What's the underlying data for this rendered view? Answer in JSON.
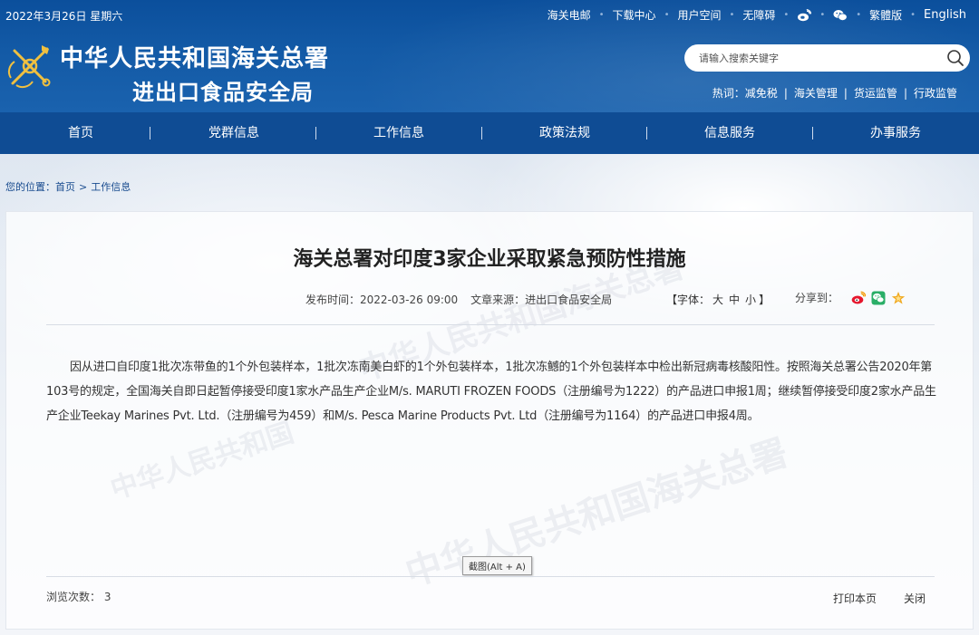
{
  "topbar": {
    "date": "2022年3月26日 星期六",
    "links": [
      {
        "label": "海关电邮"
      },
      {
        "label": "下载中心"
      },
      {
        "label": "用户空间"
      },
      {
        "label": "无障碍"
      },
      {
        "icon": "weibo-icon"
      },
      {
        "icon": "wechat-icon"
      },
      {
        "label": "繁體版"
      },
      {
        "label": "English"
      }
    ]
  },
  "brand": {
    "line1": "中华人民共和国海关总署",
    "line2": "进出口食品安全局",
    "emblem": "customs-emblem-icon"
  },
  "search": {
    "placeholder": "请输入搜索关键字",
    "icon": "search-icon"
  },
  "hotwords": {
    "label": "热词：",
    "items": [
      "减免税",
      "海关管理",
      "货运监管",
      "行政监管"
    ],
    "separator": "|"
  },
  "nav": {
    "items": [
      "首页",
      "党群信息",
      "工作信息",
      "政策法规",
      "信息服务",
      "办事服务"
    ],
    "separator": "|"
  },
  "breadcrumb": {
    "prefix": "您的位置：",
    "items": [
      "首页",
      "工作信息"
    ],
    "separator": ">"
  },
  "article": {
    "title": "海关总署对印度3家企业采取紧急预防性措施",
    "publish_label": "发布时间：",
    "publish_time": "2022-03-26 09:00",
    "source_label": "文章来源：",
    "source": "进出口食品安全局",
    "font_label_open": "【字体：",
    "font_sizes": [
      "大",
      "中",
      "小"
    ],
    "font_label_close": "】",
    "share_label": "分享到：",
    "body": "因从进口自印度1批次冻带鱼的1个外包装样本，1批次冻南美白虾的1个外包装样本，1批次冻鳡的1个外包装样本中检出新冠病毒核酸阳性。按照海关总署公告2020年第103号的规定，全国海关自即日起暂停接受印度1家水产品生产企业M/s. MARUTI FROZEN FOODS（注册编号为1222）的产品进口申报1周；继续暂停接受印度2家水产品生产企业Teekay Marines Pvt. Ltd.（注册编号为459）和M/s. Pesca Marine Products Pvt. Ltd（注册编号为1164）的产品进口申报4周。",
    "views_label": "浏览次数：",
    "views": "3",
    "print": "打印本页",
    "close": "关闭"
  },
  "tooltip": "截图(Alt + A)",
  "colors": {
    "header_blue": "#135aa6",
    "nav_blue": "#0f4c94",
    "link_blue": "#184b8f",
    "weibo_red": "#e6162d",
    "wechat_green": "#2aae67",
    "star_gold": "#f0a81e"
  }
}
